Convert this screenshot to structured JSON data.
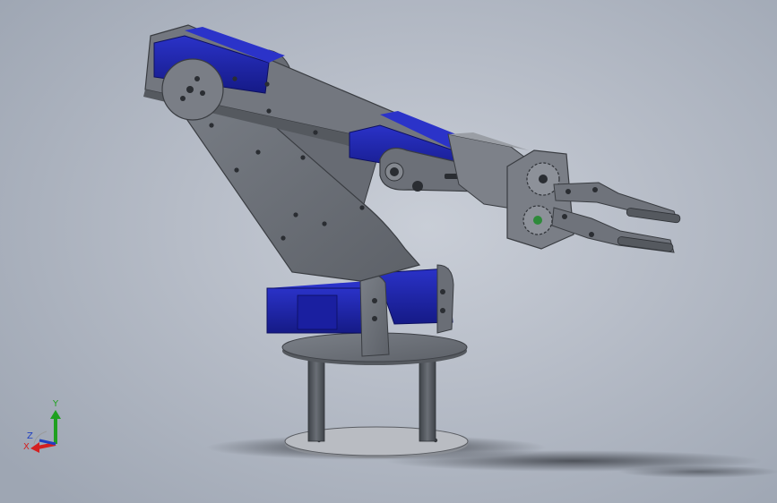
{
  "viewport": {
    "model": "robotic-arm-assembly",
    "view": "isometric"
  },
  "triad": {
    "x_label": "X",
    "y_label": "Y",
    "z_label": "Z",
    "x_color": "#d42020",
    "y_color": "#20a020",
    "z_color": "#2040c0"
  },
  "colors": {
    "background_center": "#c9ced7",
    "background_edge": "#9ea6b3",
    "plate": "#6f737b",
    "plate_edge": "#4a4d54",
    "servo_blue": "#1d23a8",
    "servo_dark": "#0f1370",
    "standoff": "#55595f",
    "base_disc": "#b9bcc2"
  }
}
